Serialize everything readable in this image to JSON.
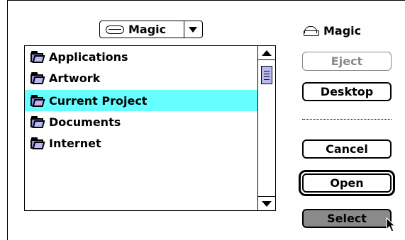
{
  "volume_popup": {
    "selected": "Magic"
  },
  "files": [
    {
      "name": "Applications",
      "selected": false
    },
    {
      "name": "Artwork",
      "selected": false
    },
    {
      "name": "Current Project",
      "selected": true
    },
    {
      "name": "Documents",
      "selected": false
    },
    {
      "name": "Internet",
      "selected": false
    }
  ],
  "volume_label": "Magic",
  "buttons": {
    "eject": "Eject",
    "desktop": "Desktop",
    "cancel": "Cancel",
    "open": "Open",
    "select": "Select"
  },
  "colors": {
    "selection": "#66ffff",
    "folder": "#b9b9f0"
  }
}
